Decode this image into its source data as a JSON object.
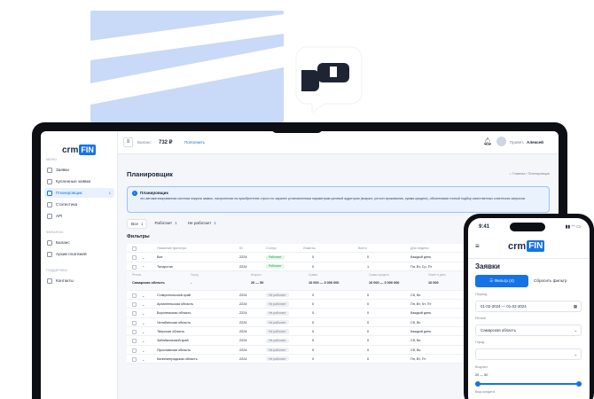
{
  "colors": {
    "accent": "#1673e6",
    "deco": "#c9d9f8",
    "active_badge": "#1f9d55"
  },
  "brand": {
    "crm": "crm",
    "fin": "FIN"
  },
  "sidebar": {
    "menu_label": "МЕНЮ",
    "menu_items": [
      {
        "label": "Заявки",
        "icon": "requests-icon"
      },
      {
        "label": "Купленные заявки",
        "icon": "cart-icon"
      },
      {
        "label": "Планировщик",
        "icon": "planner-icon",
        "count": "1",
        "active": true
      },
      {
        "label": "Статистика",
        "icon": "stats-icon"
      },
      {
        "label": "API",
        "icon": "api-icon"
      }
    ],
    "finance_label": "ФИНАНСЫ",
    "finance_items": [
      {
        "label": "Баланс",
        "icon": "wallet-icon"
      },
      {
        "label": "Архив платежей",
        "icon": "archive-icon"
      }
    ],
    "support_label": "ПОДДЕРЖКА",
    "support_items": [
      {
        "label": "Контакты",
        "icon": "contacts-icon"
      }
    ]
  },
  "topbar": {
    "balance_label": "Баланс",
    "balance": "732 ₽",
    "topup": "Пополнить",
    "greeting": "Привет,",
    "user": "Алексей"
  },
  "page": {
    "title": "Планировщик",
    "breadcrumb": "⌂ Главная / Планировщик",
    "info_title": "Планировщик",
    "info_text": "это автоматизированная система покупки заявок, настроенная на приобретение строго по заранее установленным параметрам целевой аудитории (возраст, регион проживания, сумма кредита), обеспечивая точный подбор качественных клиентских запросов.",
    "tabs": [
      {
        "label": "Все",
        "count": "1"
      },
      {
        "label": "Работает",
        "count": "1"
      },
      {
        "label": "Не работает",
        "count": "1"
      }
    ],
    "add_button": "+ Создать фильтр",
    "filters_title": "Фильтры"
  },
  "table": {
    "headers": [
      "Название фильтра",
      "ID",
      "Статус",
      "Лимиты",
      "Всего",
      "Дни недели"
    ],
    "rows": [
      {
        "name": "Все",
        "id": "2224",
        "status": "Работает",
        "limit": "0",
        "total": "0",
        "days": "Каждый день",
        "on": true
      },
      {
        "name": "Татарстан",
        "id": "2224",
        "status": "Работает",
        "limit": "0",
        "total": "1",
        "days": "Пн, Вт, Ср, Пт",
        "on": true,
        "expanded": true
      },
      {
        "name": "Ставропольский край",
        "id": "2224",
        "status": "Не работает",
        "limit": "0",
        "total": "0",
        "days": "Сб, Вс",
        "on": false
      },
      {
        "name": "Архангельская область",
        "id": "2224",
        "status": "Не работает",
        "limit": "0",
        "total": "0",
        "days": "Пн, Вт, Чт, Пт",
        "on": false
      },
      {
        "name": "Воронежская область",
        "id": "2224",
        "status": "Не работает",
        "limit": "0",
        "total": "0",
        "days": "Каждый день",
        "on": false
      },
      {
        "name": "Челябинская область",
        "id": "2224",
        "status": "Не работает",
        "limit": "0",
        "total": "0",
        "days": "Сб, Вс",
        "on": false
      },
      {
        "name": "Тверская область",
        "id": "2224",
        "status": "Не работает",
        "limit": "0",
        "total": "0",
        "days": "Каждый день",
        "on": false
      },
      {
        "name": "Забайкальский край",
        "id": "2224",
        "status": "Не работает",
        "limit": "0",
        "total": "0",
        "days": "Сб, Вс",
        "on": false
      },
      {
        "name": "Ярославская область",
        "id": "2224",
        "status": "Не работает",
        "limit": "0",
        "total": "0",
        "days": "Сб, Вс",
        "on": false
      },
      {
        "name": "Калининградская область",
        "id": "2224",
        "status": "Не работает",
        "limit": "0",
        "total": "0",
        "days": "Пн, Вт, Пт",
        "on": false
      }
    ],
    "expanded": {
      "keys": [
        "Регион",
        "Город",
        "Возраст",
        "Сумма",
        "Сумма кредита",
        "Лимит в день"
      ],
      "values": [
        "Самарская область",
        "-",
        "20 — 50",
        "10 000 — 3 000 000",
        "10 000 — 3 000 000",
        "10 000"
      ]
    }
  },
  "phone": {
    "time": "9:41",
    "status": "▮▮ ◠ ▭",
    "title": "Заявки",
    "filter_button": "☰ Фильтр (4)",
    "reset": "Сбросить фильтр",
    "period_label": "Период",
    "period_value": "01-02-2024 — 01-02-2024",
    "region_label": "Регион",
    "region_value": "Самарская область",
    "city_label": "Город",
    "city_value": "",
    "age_label": "Возраст",
    "age_value": "20 — 50",
    "range_label": "Вид кредита"
  }
}
